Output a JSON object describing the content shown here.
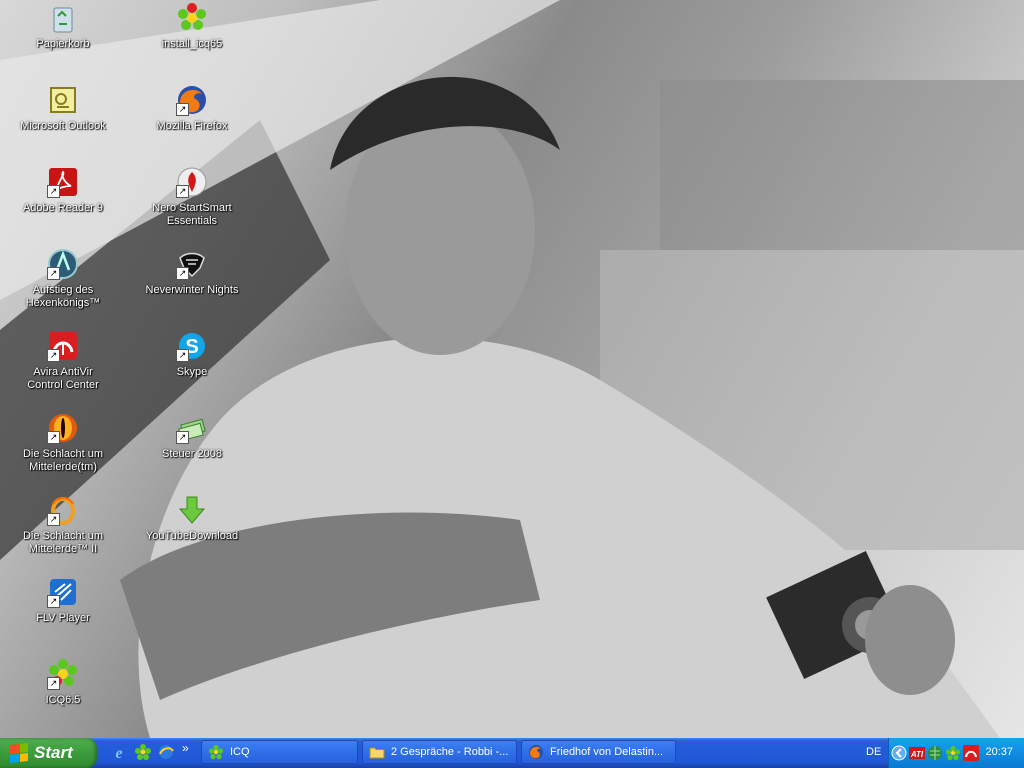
{
  "desktop": {
    "icons_left": [
      {
        "label": "Papierkorb",
        "icon": "recycle-bin-icon"
      },
      {
        "label": "Microsoft Outlook",
        "icon": "outlook-icon"
      },
      {
        "label": "Adobe Reader 9",
        "icon": "adobe-reader-icon"
      },
      {
        "label": "Aufstieg des Hexenkönigs™",
        "icon": "game-shield-icon"
      },
      {
        "label": "Avira AntiVir Control Center",
        "icon": "avira-umbrella-icon"
      },
      {
        "label": "Die Schlacht um Mittelerde(tm)",
        "icon": "eye-of-sauron-icon"
      },
      {
        "label": "Die Schlacht um Mittelerde™ II",
        "icon": "ring-icon"
      },
      {
        "label": "FLV Player",
        "icon": "flv-player-icon"
      },
      {
        "label": "ICQ6.5",
        "icon": "icq-flower-icon"
      }
    ],
    "icons_right": [
      {
        "label": "install_icq65",
        "icon": "icq-installer-icon"
      },
      {
        "label": "Mozilla Firefox",
        "icon": "firefox-icon"
      },
      {
        "label": "Nero StartSmart Essentials",
        "icon": "nero-icon"
      },
      {
        "label": "Neverwinter Nights",
        "icon": "neverwinter-icon"
      },
      {
        "label": "Skype",
        "icon": "skype-icon"
      },
      {
        "label": "Steuer 2008",
        "icon": "tax-money-icon"
      },
      {
        "label": "YouTubeDownload",
        "icon": "download-arrow-icon"
      }
    ]
  },
  "taskbar": {
    "start_label": "Start",
    "tasks": [
      {
        "label": "ICQ",
        "icon": "icq-flower-icon"
      },
      {
        "label": "2 Gespräche - Robbi -...",
        "icon": "folder-icon"
      },
      {
        "label": "Friedhof von Delastin...",
        "icon": "firefox-icon"
      }
    ],
    "quick_launch_overflow": "»",
    "language": "DE",
    "clock": "20:37"
  }
}
